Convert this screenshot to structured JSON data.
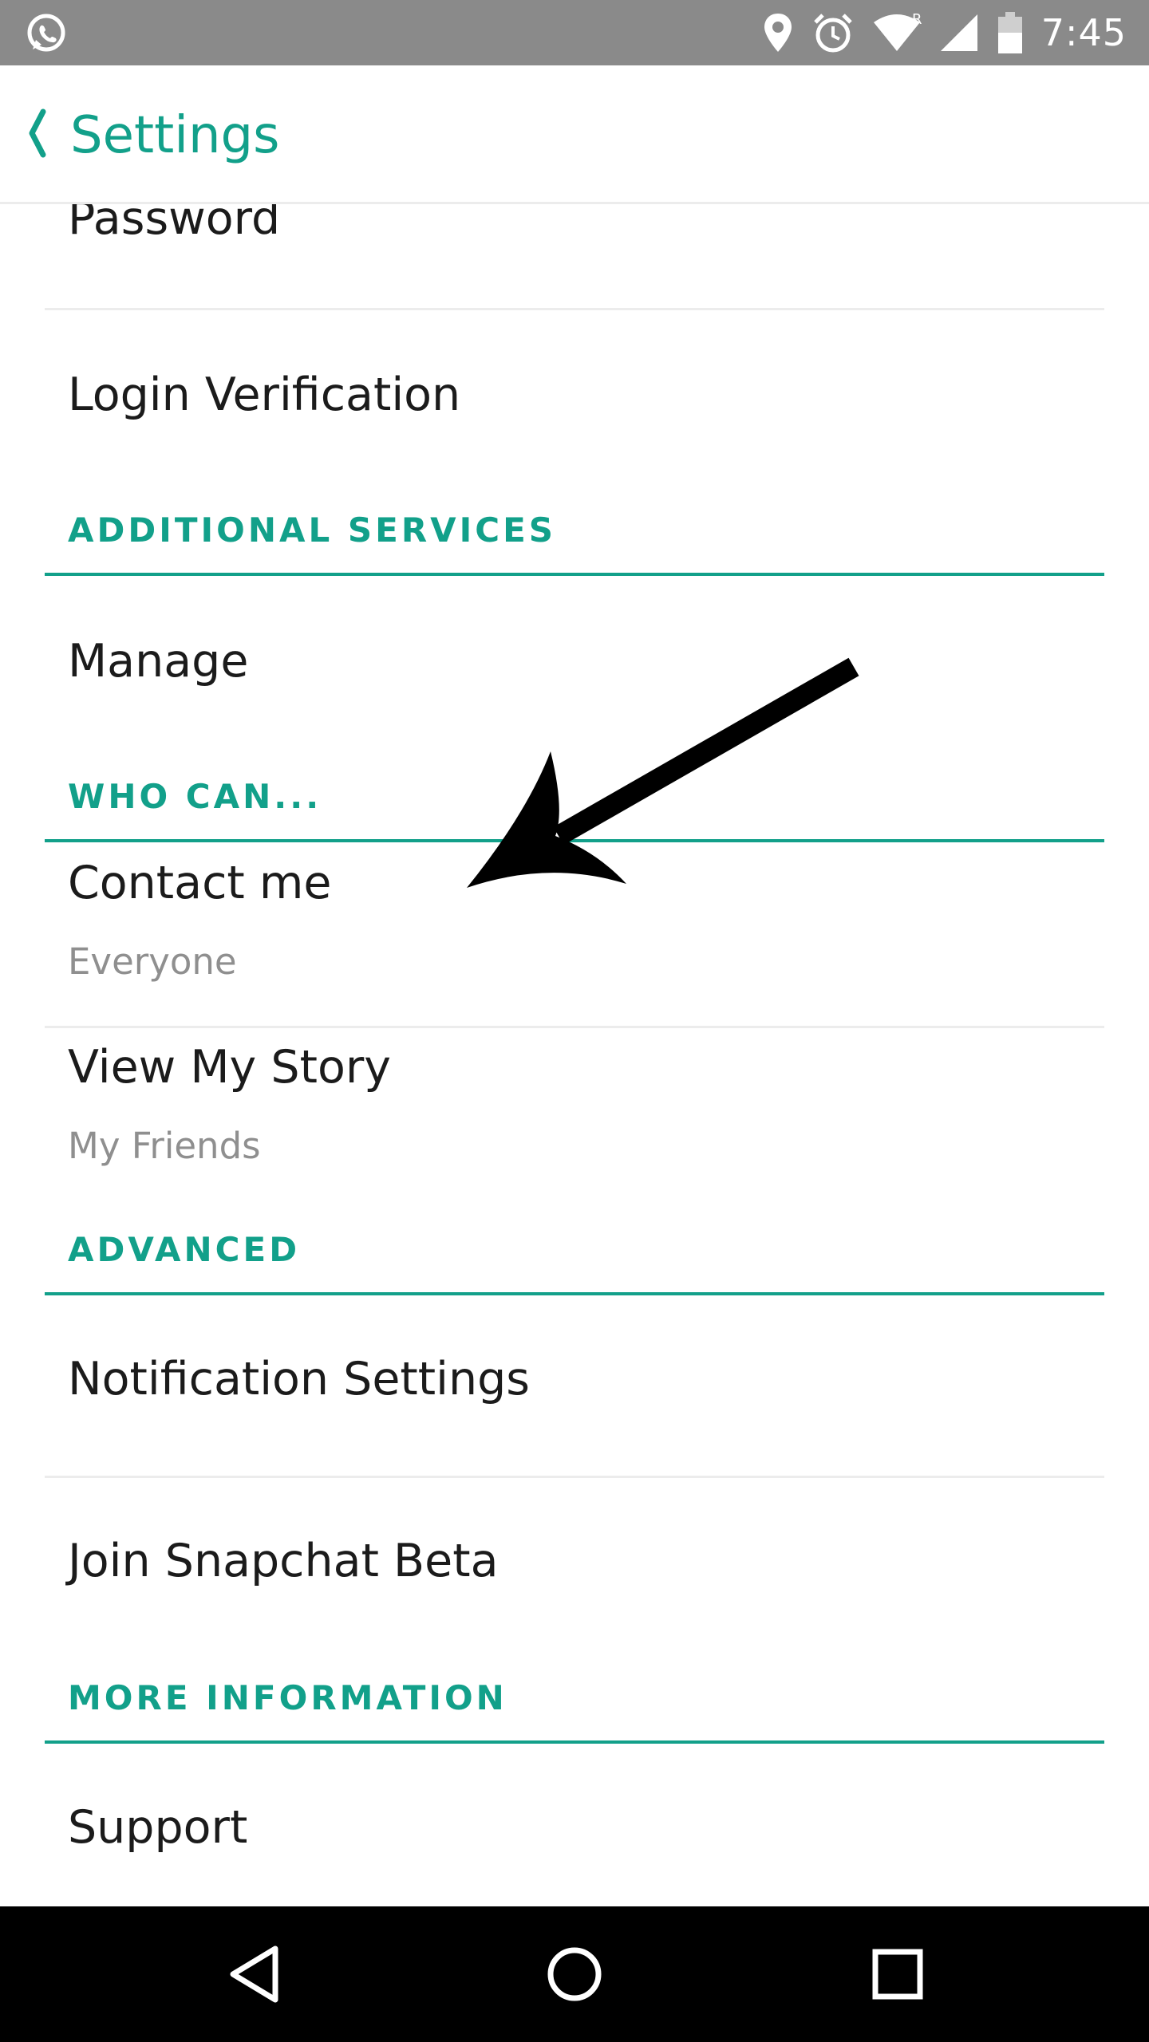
{
  "status_bar": {
    "time": "7:45",
    "icons": [
      "whatsapp-icon",
      "location-icon",
      "alarm-icon",
      "wifi-icon",
      "signal-icon",
      "battery-icon"
    ],
    "roaming_indicator": "R"
  },
  "header": {
    "title": "Settings",
    "back_icon": "chevron-left-icon"
  },
  "settings": {
    "password": "Password",
    "login_verification": "Login Verification",
    "additional_services": {
      "section": "ADDITIONAL SERVICES",
      "manage": "Manage"
    },
    "who_can": {
      "section": "WHO CAN...",
      "contact_me": {
        "title": "Contact me",
        "value": "Everyone"
      },
      "view_my_story": {
        "title": "View My Story",
        "value": "My Friends"
      }
    },
    "advanced": {
      "section": "ADVANCED",
      "notification_settings": "Notification Settings",
      "join_beta": "Join Snapchat Beta"
    },
    "more_information": {
      "section": "MORE INFORMATION",
      "support": "Support"
    }
  },
  "nav_bar": {
    "back": "nav-back-icon",
    "home": "nav-home-icon",
    "recents": "nav-recents-icon"
  },
  "colors": {
    "accent": "#12a08a",
    "status_bar": "#8a8a8a",
    "nav_bar": "#000000",
    "divider": "#ececec",
    "subtitle": "#8f8f8f"
  }
}
